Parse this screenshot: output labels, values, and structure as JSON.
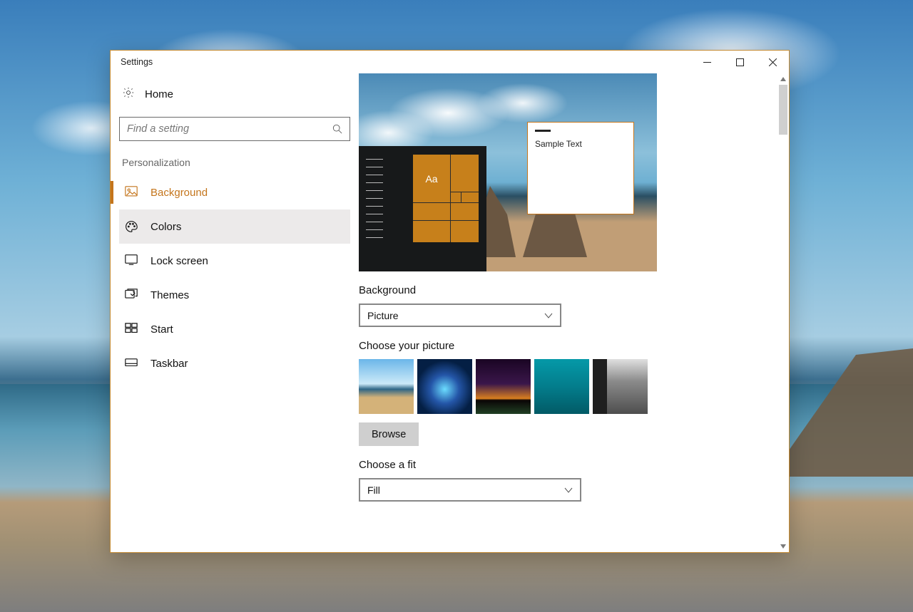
{
  "window": {
    "title": "Settings"
  },
  "sidebar": {
    "home": "Home",
    "search_placeholder": "Find a setting",
    "section": "Personalization",
    "items": [
      {
        "label": "Background"
      },
      {
        "label": "Colors"
      },
      {
        "label": "Lock screen"
      },
      {
        "label": "Themes"
      },
      {
        "label": "Start"
      },
      {
        "label": "Taskbar"
      }
    ]
  },
  "preview": {
    "start_tile_text": "Aa",
    "sample_text": "Sample Text"
  },
  "main": {
    "background_label": "Background",
    "background_value": "Picture",
    "choose_picture_label": "Choose your picture",
    "browse": "Browse",
    "fit_label": "Choose a fit",
    "fit_value": "Fill"
  },
  "colors": {
    "accent": "#c4751c"
  }
}
